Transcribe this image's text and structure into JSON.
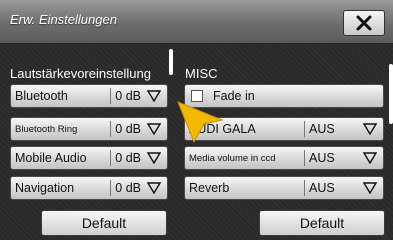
{
  "window": {
    "title": "Erw. Einstellungen"
  },
  "left": {
    "section_title": "Lautstärkevoreinstellung",
    "rows": [
      {
        "label": "Bluetooth",
        "value": "0 dB"
      },
      {
        "label": "Bluetooth Ring",
        "value": "0 dB"
      },
      {
        "label": "Mobile Audio",
        "value": "0 dB"
      },
      {
        "label": "Navigation",
        "value": "0 dB"
      }
    ],
    "default_label": "Default"
  },
  "right": {
    "section_title": "MISC",
    "fade_in": {
      "label": "Fade in",
      "checked": false
    },
    "rows": [
      {
        "label": "AUDI GALA",
        "value": "AUS"
      },
      {
        "label": "Media volume in ccd",
        "value": "AUS"
      },
      {
        "label": "Reverb",
        "value": "AUS"
      }
    ],
    "default_label": "Default"
  },
  "icons": {
    "close": "close-icon",
    "dropdown": "chevron-down-icon",
    "pointer": "arrow-pointer-icon"
  },
  "colors": {
    "pointer": "#f5b800",
    "titlebar": "#7a7a7a",
    "background": "#2a2a2a"
  }
}
